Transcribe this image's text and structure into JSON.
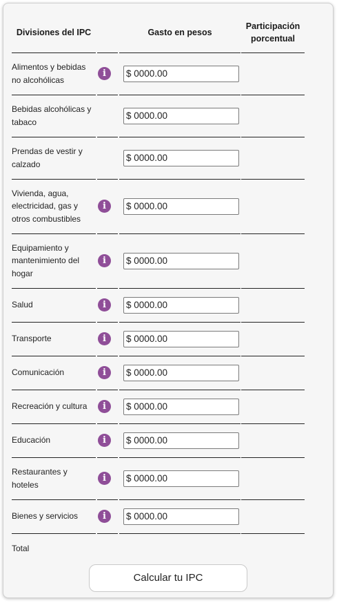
{
  "table": {
    "headers": {
      "division": "Divisiones del IPC",
      "spending": "Gasto en pesos",
      "share": "Participación porcentual"
    },
    "info_icon": "info-icon",
    "rows": [
      {
        "label": "Alimentos y bebidas no alcohólicas",
        "value": "$ 0000.00",
        "has_info": true
      },
      {
        "label": "Bebidas alcohólicas y tabaco",
        "value": "$ 0000.00",
        "has_info": false
      },
      {
        "label": "Prendas de vestir y calzado",
        "value": "$ 0000.00",
        "has_info": false
      },
      {
        "label": "Vivienda, agua, electricidad, gas y otros combustibles",
        "value": "$ 0000.00",
        "has_info": true
      },
      {
        "label": "Equipamiento y mantenimiento del hogar",
        "value": "$ 0000.00",
        "has_info": true
      },
      {
        "label": "Salud",
        "value": "$ 0000.00",
        "has_info": true
      },
      {
        "label": "Transporte",
        "value": "$ 0000.00",
        "has_info": true
      },
      {
        "label": "Comunicación",
        "value": "$ 0000.00",
        "has_info": true
      },
      {
        "label": "Recreación y cultura",
        "value": "$ 0000.00",
        "has_info": true
      },
      {
        "label": "Educación",
        "value": "$ 0000.00",
        "has_info": true
      },
      {
        "label": "Restaurantes y hoteles",
        "value": "$ 0000.00",
        "has_info": true
      },
      {
        "label": "Bienes y servicios",
        "value": "$ 0000.00",
        "has_info": true
      }
    ],
    "total_label": "Total"
  },
  "button": {
    "label": "Calcular tu IPC"
  },
  "colors": {
    "info_icon": "#8f4e98",
    "rule": "#222222"
  }
}
